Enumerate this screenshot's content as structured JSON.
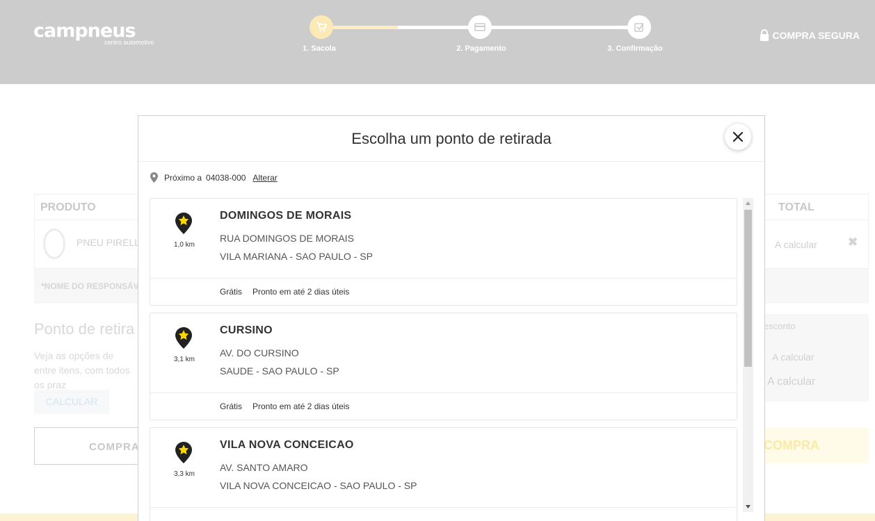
{
  "header": {
    "logo_main": "campneus",
    "logo_sub": "centro automotivo",
    "secure_label": "COMPRA SEGURA",
    "steps": [
      {
        "label": "1. Sacola",
        "icon": "cart-icon",
        "active": true
      },
      {
        "label": "2. Pagamento",
        "icon": "credit-card-icon",
        "active": false
      },
      {
        "label": "3. Confirmação",
        "icon": "checkmark-icon",
        "active": false
      }
    ],
    "progress_fraction": 0.24
  },
  "background": {
    "col_product": "PRODUTO",
    "col_total": "TOTAL",
    "product_name": "PNEU PIRELLI",
    "total_value": "A calcular",
    "responsible_label": "*NOME DO RESPONSÁV",
    "pickup_title": "Ponto de retira",
    "pickup_text": "Veja as opções de entre itens, com todos os praz",
    "calc_button": "CALCULAR",
    "buy_button": "COMPRA",
    "discount_label": "esconto",
    "summary_value_1": "A calcular",
    "summary_value_2": "A calcular",
    "buy_right": "COMPRA"
  },
  "modal": {
    "title": "Escolha um ponto de retirada",
    "near_label": "Próximo a",
    "cep": "04038-000",
    "change_link": "Alterar",
    "stores": [
      {
        "name": "DOMINGOS DE MORAIS",
        "street": "RUA DOMINGOS DE MORAIS",
        "city": "VILA MARIANA - SAO PAULO - SP",
        "distance": "1,0 km",
        "price": "Grátis",
        "time": "Pronto em até 2 dias úteis"
      },
      {
        "name": "CURSINO",
        "street": "AV. DO CURSINO",
        "city": "SAUDE - SAO PAULO - SP",
        "distance": "3,1 km",
        "price": "Grátis",
        "time": "Pronto em até 2 dias úteis"
      },
      {
        "name": "VILA NOVA CONCEICAO",
        "street": "AV. SANTO AMARO",
        "city": "VILA NOVA CONCEICAO - SAO PAULO - SP",
        "distance": "3,3 km",
        "price": "",
        "time": ""
      }
    ]
  },
  "colors": {
    "header_bg": "#cccccc",
    "accent_yellow": "#ffd700",
    "marker_dark": "#222222"
  }
}
